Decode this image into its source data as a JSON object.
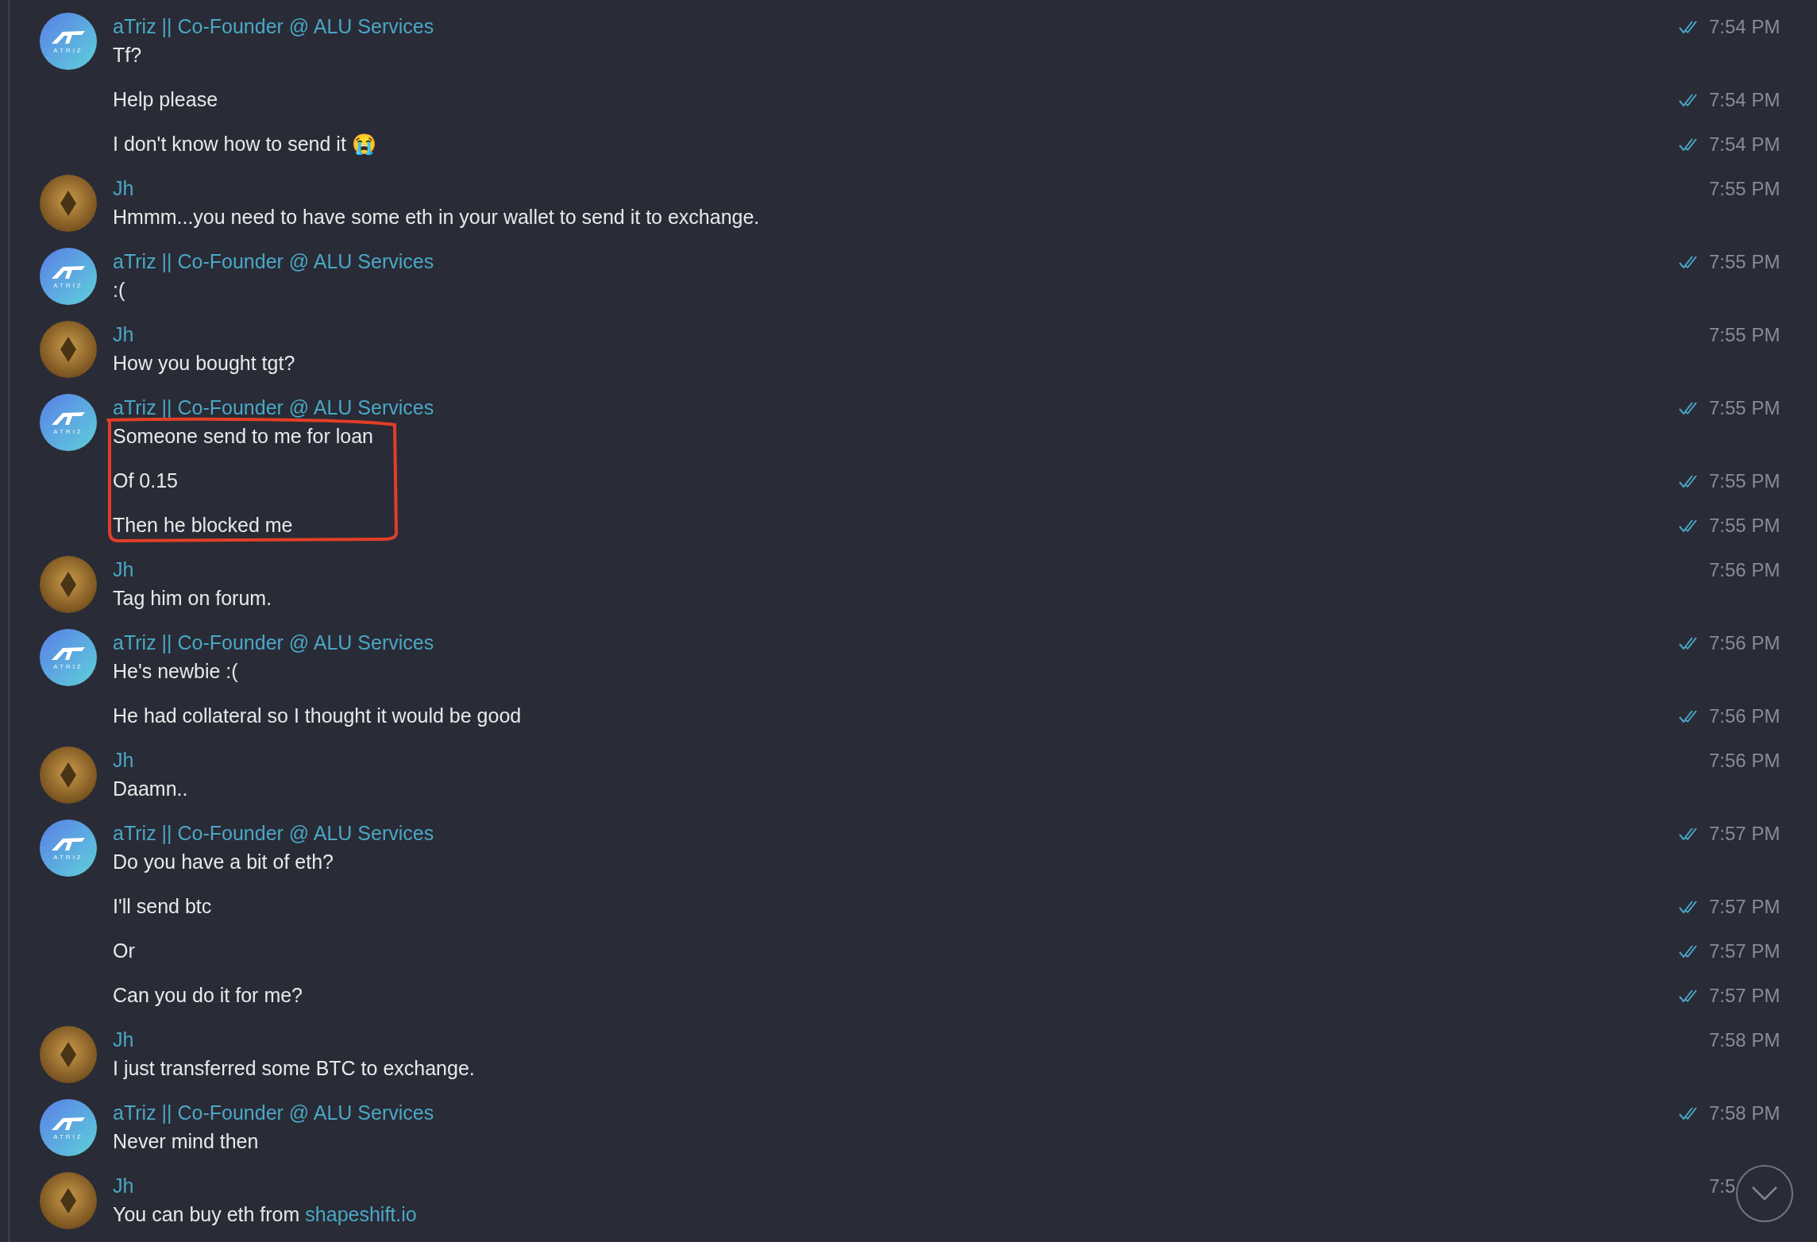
{
  "chat": {
    "groups": [
      {
        "sender": "aTriz || Co-Founder @ ALU Services",
        "avatar": {
          "kind": "logo",
          "label": "ATRIZ"
        },
        "messages": [
          {
            "text": "Tf?",
            "time": "7:54 PM",
            "read": true,
            "circled": false
          },
          {
            "text": "Help please",
            "time": "7:54 PM",
            "read": true,
            "circled": false
          },
          {
            "text": "I don't know how to send it 😭",
            "time": "7:54 PM",
            "read": true,
            "circled": false
          }
        ]
      },
      {
        "sender": "Jh",
        "avatar": {
          "kind": "photo"
        },
        "messages": [
          {
            "text": "Hmmm...you need to have some eth in your wallet to send it to exchange.",
            "time": "7:55 PM",
            "read": false,
            "circled": false
          }
        ]
      },
      {
        "sender": "aTriz || Co-Founder @ ALU Services",
        "avatar": {
          "kind": "logo",
          "label": "ATRIZ"
        },
        "messages": [
          {
            "text": ":(",
            "time": "7:55 PM",
            "read": true,
            "circled": false
          }
        ]
      },
      {
        "sender": "Jh",
        "avatar": {
          "kind": "photo"
        },
        "messages": [
          {
            "text": "How you bought tgt?",
            "time": "7:55 PM",
            "read": false,
            "circled": false
          }
        ]
      },
      {
        "sender": "aTriz || Co-Founder @ ALU Services",
        "avatar": {
          "kind": "logo",
          "label": "ATRIZ"
        },
        "messages": [
          {
            "text": "Someone send to me for loan",
            "time": "7:55 PM",
            "read": true,
            "circled": true
          },
          {
            "text": "Of 0.15",
            "time": "7:55 PM",
            "read": true,
            "circled": true
          },
          {
            "text": "Then he blocked me",
            "time": "7:55 PM",
            "read": true,
            "circled": true
          }
        ]
      },
      {
        "sender": "Jh",
        "avatar": {
          "kind": "photo"
        },
        "messages": [
          {
            "text": "Tag him on forum.",
            "time": "7:56 PM",
            "read": false,
            "circled": false
          }
        ]
      },
      {
        "sender": "aTriz || Co-Founder @ ALU Services",
        "avatar": {
          "kind": "logo",
          "label": "ATRIZ"
        },
        "messages": [
          {
            "text": "He's newbie :(",
            "time": "7:56 PM",
            "read": true,
            "circled": false
          },
          {
            "text": "He had collateral so I thought it would be good",
            "time": "7:56 PM",
            "read": true,
            "circled": false
          }
        ]
      },
      {
        "sender": "Jh",
        "avatar": {
          "kind": "photo"
        },
        "messages": [
          {
            "text": "Daamn..",
            "time": "7:56 PM",
            "read": false,
            "circled": false
          }
        ]
      },
      {
        "sender": "aTriz || Co-Founder @ ALU Services",
        "avatar": {
          "kind": "logo",
          "label": "ATRIZ"
        },
        "messages": [
          {
            "text": "Do you have a bit of eth?",
            "time": "7:57 PM",
            "read": true,
            "circled": false
          },
          {
            "text": "I'll send btc",
            "time": "7:57 PM",
            "read": true,
            "circled": false
          },
          {
            "text": "Or",
            "time": "7:57 PM",
            "read": true,
            "circled": false
          },
          {
            "text": "Can you do it for me?",
            "time": "7:57 PM",
            "read": true,
            "circled": false
          }
        ]
      },
      {
        "sender": "Jh",
        "avatar": {
          "kind": "photo"
        },
        "messages": [
          {
            "text": "I just transferred some BTC to exchange.",
            "time": "7:58 PM",
            "read": false,
            "circled": false
          }
        ]
      },
      {
        "sender": "aTriz || Co-Founder @ ALU Services",
        "avatar": {
          "kind": "logo",
          "label": "ATRIZ"
        },
        "messages": [
          {
            "text": "Never mind then",
            "time": "7:58 PM",
            "read": true,
            "circled": false
          }
        ]
      },
      {
        "sender": "Jh",
        "avatar": {
          "kind": "photo"
        },
        "messages": [
          {
            "text": "You can buy eth from",
            "link": "shapeshift.io",
            "time": "7:5",
            "read": false,
            "circled": false
          }
        ]
      }
    ]
  }
}
